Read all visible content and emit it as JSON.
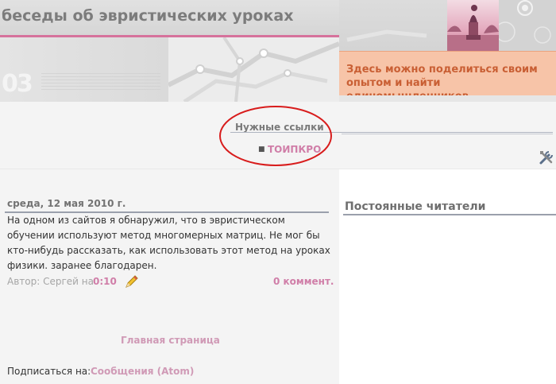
{
  "header": {
    "title": "беседы об эвристических уроках",
    "number_graphic": "03",
    "notice": "Здесь можно поделиться своим опытом и найти единомышленников"
  },
  "links": {
    "title": "Нужные ссылки",
    "items": [
      {
        "label": "ТОИПКРО"
      }
    ]
  },
  "post": {
    "date": "среда, 12 мая 2010 г.",
    "body": "На одном из сайтов я обнаружил, что в эвристическом обучении используют метод многомерных матриц. Не мог бы кто-нибудь рассказать, как использовать этот метод на уроках физики. заранее благодарен.",
    "byline": "Автор: Сергей на",
    "time": "0:10",
    "comments": "0 коммент."
  },
  "footer": {
    "home": "Главная страница",
    "subscribe_label": "Подписаться на:",
    "subscribe_link": "Сообщения (Atom)"
  },
  "sidebar": {
    "followers_title": "Постоянные читатели"
  },
  "icons": {
    "edit": "pencil-icon",
    "widget_tools": "tools-icon"
  },
  "colors": {
    "accent_pink": "#d07ea8",
    "notice_bg": "#f7c4a8",
    "notice_text": "#c95f34",
    "annotation_red": "#d81c1c"
  }
}
